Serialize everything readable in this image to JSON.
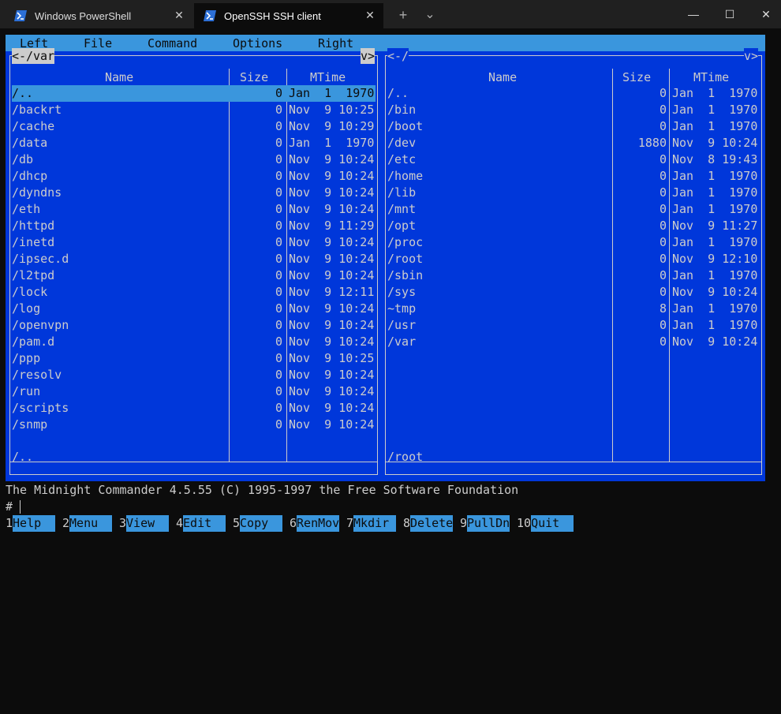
{
  "window": {
    "tabs": [
      {
        "title": "Windows PowerShell",
        "active": false
      },
      {
        "title": "OpenSSH SSH client",
        "active": true
      }
    ],
    "new_tab": "+",
    "dropdown": "⌄",
    "minimize": "—",
    "maximize": "☐",
    "close": "✕",
    "tab_close": "✕"
  },
  "menu": [
    "Left",
    "File",
    "Command",
    "Options",
    "Right"
  ],
  "left_panel": {
    "left_tab": "<-",
    "path": "/var",
    "right_tab": "v>",
    "columns": [
      "Name",
      "Size",
      "MTime"
    ],
    "rows": [
      {
        "name": "/..",
        "size": "0",
        "mtime": "Jan  1  1970",
        "selected": true
      },
      {
        "name": "/backrt",
        "size": "0",
        "mtime": "Nov  9 10:25"
      },
      {
        "name": "/cache",
        "size": "0",
        "mtime": "Nov  9 10:29"
      },
      {
        "name": "/data",
        "size": "0",
        "mtime": "Jan  1  1970"
      },
      {
        "name": "/db",
        "size": "0",
        "mtime": "Nov  9 10:24"
      },
      {
        "name": "/dhcp",
        "size": "0",
        "mtime": "Nov  9 10:24"
      },
      {
        "name": "/dyndns",
        "size": "0",
        "mtime": "Nov  9 10:24"
      },
      {
        "name": "/eth",
        "size": "0",
        "mtime": "Nov  9 10:24"
      },
      {
        "name": "/httpd",
        "size": "0",
        "mtime": "Nov  9 11:29"
      },
      {
        "name": "/inetd",
        "size": "0",
        "mtime": "Nov  9 10:24"
      },
      {
        "name": "/ipsec.d",
        "size": "0",
        "mtime": "Nov  9 10:24"
      },
      {
        "name": "/l2tpd",
        "size": "0",
        "mtime": "Nov  9 10:24"
      },
      {
        "name": "/lock",
        "size": "0",
        "mtime": "Nov  9 12:11"
      },
      {
        "name": "/log",
        "size": "0",
        "mtime": "Nov  9 10:24"
      },
      {
        "name": "/openvpn",
        "size": "0",
        "mtime": "Nov  9 10:24"
      },
      {
        "name": "/pam.d",
        "size": "0",
        "mtime": "Nov  9 10:24"
      },
      {
        "name": "/ppp",
        "size": "0",
        "mtime": "Nov  9 10:25"
      },
      {
        "name": "/resolv",
        "size": "0",
        "mtime": "Nov  9 10:24"
      },
      {
        "name": "/run",
        "size": "0",
        "mtime": "Nov  9 10:24"
      },
      {
        "name": "/scripts",
        "size": "0",
        "mtime": "Nov  9 10:24"
      },
      {
        "name": "/snmp",
        "size": "0",
        "mtime": "Nov  9 10:24"
      }
    ],
    "mini_status": "/.."
  },
  "right_panel": {
    "header": "<-/",
    "right_tab": "v>",
    "columns": [
      "Name",
      "Size",
      "MTime"
    ],
    "rows": [
      {
        "name": "/..",
        "size": "0",
        "mtime": "Jan  1  1970"
      },
      {
        "name": "/bin",
        "size": "0",
        "mtime": "Jan  1  1970"
      },
      {
        "name": "/boot",
        "size": "0",
        "mtime": "Jan  1  1970"
      },
      {
        "name": "/dev",
        "size": "1880",
        "mtime": "Nov  9 10:24"
      },
      {
        "name": "/etc",
        "size": "0",
        "mtime": "Nov  8 19:43"
      },
      {
        "name": "/home",
        "size": "0",
        "mtime": "Jan  1  1970"
      },
      {
        "name": "/lib",
        "size": "0",
        "mtime": "Jan  1  1970"
      },
      {
        "name": "/mnt",
        "size": "0",
        "mtime": "Jan  1  1970"
      },
      {
        "name": "/opt",
        "size": "0",
        "mtime": "Nov  9 11:27"
      },
      {
        "name": "/proc",
        "size": "0",
        "mtime": "Jan  1  1970"
      },
      {
        "name": "/root",
        "size": "0",
        "mtime": "Nov  9 12:10"
      },
      {
        "name": "/sbin",
        "size": "0",
        "mtime": "Jan  1  1970"
      },
      {
        "name": "/sys",
        "size": "0",
        "mtime": "Nov  9 10:24"
      },
      {
        "name": "~tmp",
        "size": "8",
        "mtime": "Jan  1  1970"
      },
      {
        "name": "/usr",
        "size": "0",
        "mtime": "Jan  1  1970"
      },
      {
        "name": "/var",
        "size": "0",
        "mtime": "Nov  9 10:24"
      }
    ],
    "mini_status": "/root"
  },
  "status_line": "The Midnight Commander 4.5.55 (C) 1995-1997 the Free Software Foundation",
  "prompt": "#",
  "function_keys": [
    {
      "num": "1",
      "label": "Help"
    },
    {
      "num": "2",
      "label": "Menu"
    },
    {
      "num": "3",
      "label": "View"
    },
    {
      "num": "4",
      "label": "Edit"
    },
    {
      "num": "5",
      "label": "Copy"
    },
    {
      "num": "6",
      "label": "RenMov"
    },
    {
      "num": "7",
      "label": "Mkdir"
    },
    {
      "num": "8",
      "label": "Delete"
    },
    {
      "num": "9",
      "label": "PullDn"
    },
    {
      "num": "10",
      "label": "Quit"
    }
  ],
  "colors": {
    "panel_bg": "#0037da",
    "highlight": "#3a96dd",
    "terminal_bg": "#0c0c0c",
    "fg": "#cccccc"
  }
}
